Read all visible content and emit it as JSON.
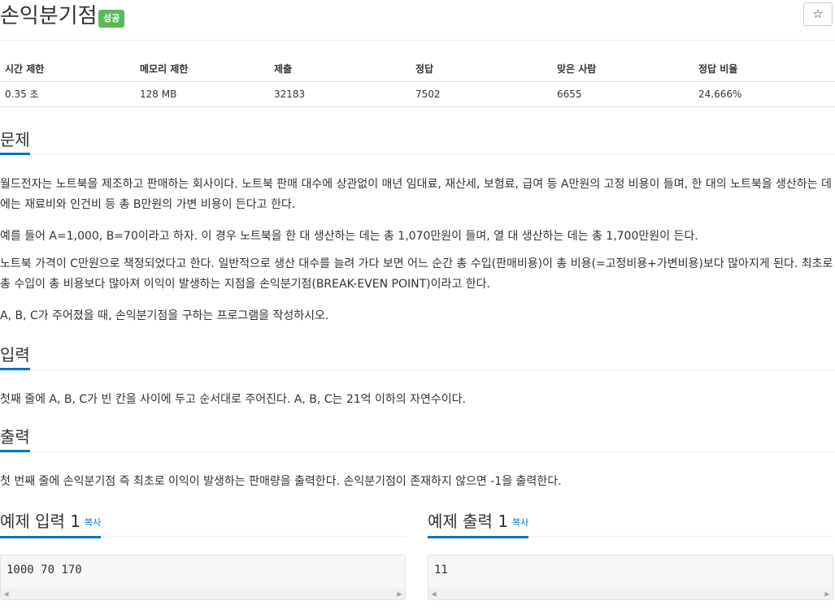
{
  "header": {
    "title": "손익분기점",
    "status_badge": "성공",
    "star_icon": "☆"
  },
  "info_table": {
    "columns": [
      "시간 제한",
      "메모리 제한",
      "제출",
      "정답",
      "맞은 사람",
      "정답 비율"
    ],
    "values": [
      "0.35 초",
      "128 MB",
      "32183",
      "7502",
      "6655",
      "24.666%"
    ]
  },
  "problem": {
    "heading": "문제",
    "paragraphs": [
      "월드전자는 노트북을 제조하고 판매하는 회사이다. 노트북 판매 대수에 상관없이 매년 임대료, 재산세, 보험료, 급여 등 A만원의 고정 비용이 들며, 한 대의 노트북을 생산하는 데에는 재료비와 인건비 등 총 B만원의 가변 비용이 든다고 한다.",
      "예를 들어 A=1,000, B=70이라고 하자. 이 경우 노트북을 한 대 생산하는 데는 총 1,070만원이 들며, 열 대 생산하는 데는 총 1,700만원이 든다.",
      "노트북 가격이 C만원으로 책정되었다고 한다. 일반적으로 생산 대수를 늘려 가다 보면 어느 순간 총 수입(판매비용)이 총 비용(=고정비용+가변비용)보다 많아지게 된다. 최초로 총 수입이 총 비용보다 많아져 이익이 발생하는 지점을 손익분기점(BREAK-EVEN POINT)이라고 한다.",
      "A, B, C가 주어졌을 때, 손익분기점을 구하는 프로그램을 작성하시오."
    ]
  },
  "input_section": {
    "heading": "입력",
    "text": "첫째 줄에 A, B, C가 빈 칸을 사이에 두고 순서대로 주어진다. A, B, C는 21억 이하의 자연수이다."
  },
  "output_section": {
    "heading": "출력",
    "text": "첫 번째 줄에 손익분기점 즉 최초로 이익이 발생하는 판매량을 출력한다. 손익분기점이 존재하지 않으면 -1을 출력한다."
  },
  "samples": {
    "input_title": "예제 입력 1",
    "output_title": "예제 출력 1",
    "copy_label": "복사",
    "input_value": "1000 70 170",
    "output_value": "11"
  },
  "colors": {
    "badge": "#5cb85c",
    "accent": "#0076c0"
  }
}
